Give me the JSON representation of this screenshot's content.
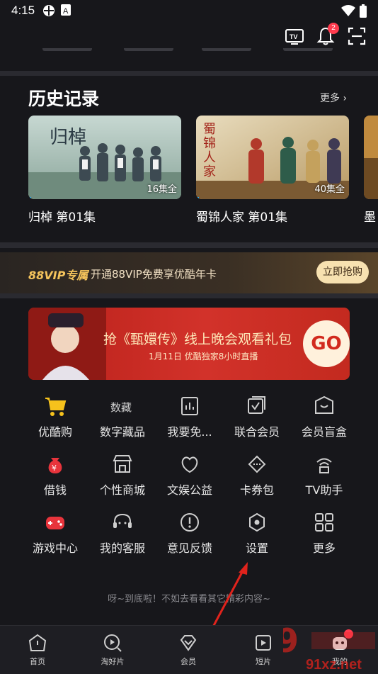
{
  "status": {
    "time": "4:15"
  },
  "topbar": {
    "notification_count": "2"
  },
  "history": {
    "title": "历史记录",
    "more_label": "更多 ›",
    "items": [
      {
        "title": "归棹 第01集",
        "episodes": "16集全",
        "poster_text": "归棹",
        "progress": 0.02
      },
      {
        "title": "蜀锦人家 第01集",
        "episodes": "40集全",
        "poster_text": "蜀锦人家",
        "progress": 0.02
      },
      {
        "title": "墨",
        "episodes": "",
        "poster_text": "",
        "progress": 0.02
      }
    ]
  },
  "vip": {
    "brand": "88VIP专属",
    "text": "开通88VIP免费享优酷年卡",
    "button": "立即抢购"
  },
  "banner": {
    "line1": "抢《甄嬛传》线上晚会观看礼包",
    "line2": "1月11日 优酷独家8小时直播",
    "go": "GO"
  },
  "grid": [
    {
      "label": "优酷购",
      "icon": "cart-icon"
    },
    {
      "label": "数字藏品",
      "icon": "collectibles-icon"
    },
    {
      "label": "我要免...",
      "icon": "free-icon"
    },
    {
      "label": "联合会员",
      "icon": "joint-member-icon"
    },
    {
      "label": "会员盲盒",
      "icon": "blind-box-icon"
    },
    {
      "label": "借钱",
      "icon": "money-bag-icon"
    },
    {
      "label": "个性商城",
      "icon": "store-icon"
    },
    {
      "label": "文娱公益",
      "icon": "charity-icon"
    },
    {
      "label": "卡券包",
      "icon": "coupon-icon"
    },
    {
      "label": "TV助手",
      "icon": "tv-assistant-icon"
    },
    {
      "label": "游戏中心",
      "icon": "game-icon"
    },
    {
      "label": "我的客服",
      "icon": "headset-icon"
    },
    {
      "label": "意见反馈",
      "icon": "feedback-icon"
    },
    {
      "label": "设置",
      "icon": "settings-icon"
    },
    {
      "label": "更多",
      "icon": "more-grid-icon"
    }
  ],
  "footer_note": "呀~到底啦！不如去看看其它精彩内容~",
  "tabs": [
    {
      "label": "首页",
      "icon": "home-icon"
    },
    {
      "label": "淘好片",
      "icon": "discover-icon"
    },
    {
      "label": "会员",
      "icon": "vip-diamond-icon"
    },
    {
      "label": "短片",
      "icon": "short-video-icon"
    },
    {
      "label": "我的",
      "icon": "profile-icon"
    }
  ],
  "watermark": "91xz.net",
  "colors": {
    "accent_blue": "#2ab4ff",
    "vip_gold": "#f5c45c",
    "badge_red": "#ff3b4e",
    "arrow_red": "#e0231c"
  }
}
